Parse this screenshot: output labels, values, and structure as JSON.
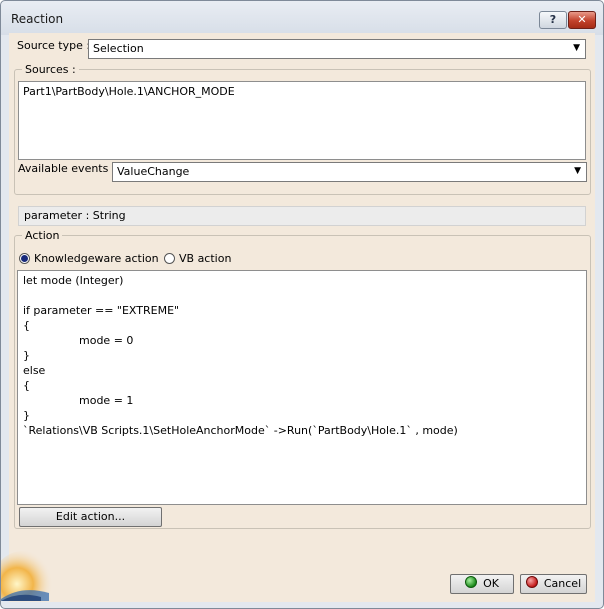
{
  "window": {
    "title": "Reaction",
    "help_label": "?",
    "close_label": "✕"
  },
  "source_type": {
    "label": "Source type :",
    "value": "Selection"
  },
  "sources": {
    "legend": "Sources :",
    "items": [
      "Part1\\PartBody\\Hole.1\\ANCHOR_MODE"
    ]
  },
  "events": {
    "label": "Available events :",
    "value": "ValueChange"
  },
  "parameter_info": "parameter : String",
  "action": {
    "legend": "Action",
    "radio_knowledgeware": "Knowledgeware action",
    "radio_vb": "VB action",
    "selected": "knowledgeware",
    "code_lines": [
      {
        "text": "let mode (Integer)",
        "indent": false
      },
      {
        "text": "",
        "indent": false
      },
      {
        "text": "if parameter == \"EXTREME\"",
        "indent": false
      },
      {
        "text": "{",
        "indent": false
      },
      {
        "text": "mode = 0",
        "indent": true
      },
      {
        "text": "}",
        "indent": false
      },
      {
        "text": "else",
        "indent": false
      },
      {
        "text": "{",
        "indent": false
      },
      {
        "text": "mode = 1",
        "indent": true
      },
      {
        "text": "}",
        "indent": false
      },
      {
        "text": "`Relations\\VB Scripts.1\\SetHoleAnchorMode` ->Run(`PartBody\\Hole.1` , mode)",
        "indent": false
      }
    ],
    "edit_button": "Edit action..."
  },
  "buttons": {
    "ok": "OK",
    "cancel": "Cancel"
  },
  "icons": {
    "ok": "green-circle-icon",
    "cancel": "red-circle-icon",
    "dropdown": "chevron-down-icon",
    "logo": "catia-logo-icon"
  }
}
